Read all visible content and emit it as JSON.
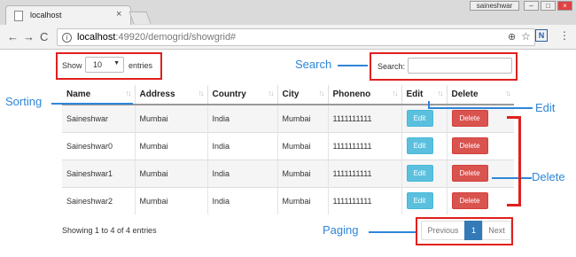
{
  "browser": {
    "tab_title": "localhost",
    "tab_close": "×",
    "user_badge": "saineshwar",
    "window_buttons": [
      "–",
      "□",
      "×"
    ],
    "back": "←",
    "forward": "→",
    "reload": "C",
    "url_host": "localhost",
    "url_path": ":49920/demogrid/showgrid#",
    "zoom_icon": "⊕",
    "star_icon": "☆",
    "extension_label": "N",
    "menu_icon": "⋮"
  },
  "grid": {
    "show_label": "Show",
    "entries_label": "entries",
    "page_length": "10",
    "search_label": "Search:",
    "search_value": "",
    "columns": [
      "Name",
      "Address",
      "Country",
      "City",
      "Phoneno",
      "Edit",
      "Delete"
    ],
    "rows": [
      {
        "name": "Saineshwar",
        "address": "Mumbai",
        "country": "India",
        "city": "Mumbai",
        "phone": "1111111111",
        "edit": "Edit",
        "delete": "Delete"
      },
      {
        "name": "Saineshwar0",
        "address": "Mumbai",
        "country": "India",
        "city": "Mumbai",
        "phone": "1111111111",
        "edit": "Edit",
        "delete": "Delete"
      },
      {
        "name": "Saineshwar1",
        "address": "Mumbai",
        "country": "India",
        "city": "Mumbai",
        "phone": "1111111111",
        "edit": "Edit",
        "delete": "Delete"
      },
      {
        "name": "Saineshwar2",
        "address": "Mumbai",
        "country": "India",
        "city": "Mumbai",
        "phone": "1111111111",
        "edit": "Edit",
        "delete": "Delete"
      }
    ],
    "info": "Showing 1 to 4 of 4 entries",
    "pager": {
      "previous": "Previous",
      "current": "1",
      "next": "Next"
    }
  },
  "annotations": {
    "search": "Search",
    "sorting": "Sorting",
    "edit": "Edit",
    "delete": "Delete",
    "paging": "Paging"
  },
  "colors": {
    "annotation_red": "#e0201e",
    "annotation_blue": "#2f86d8",
    "edit_button": "#5bc0de",
    "delete_button": "#d9534f",
    "pager_active": "#337ab7"
  }
}
